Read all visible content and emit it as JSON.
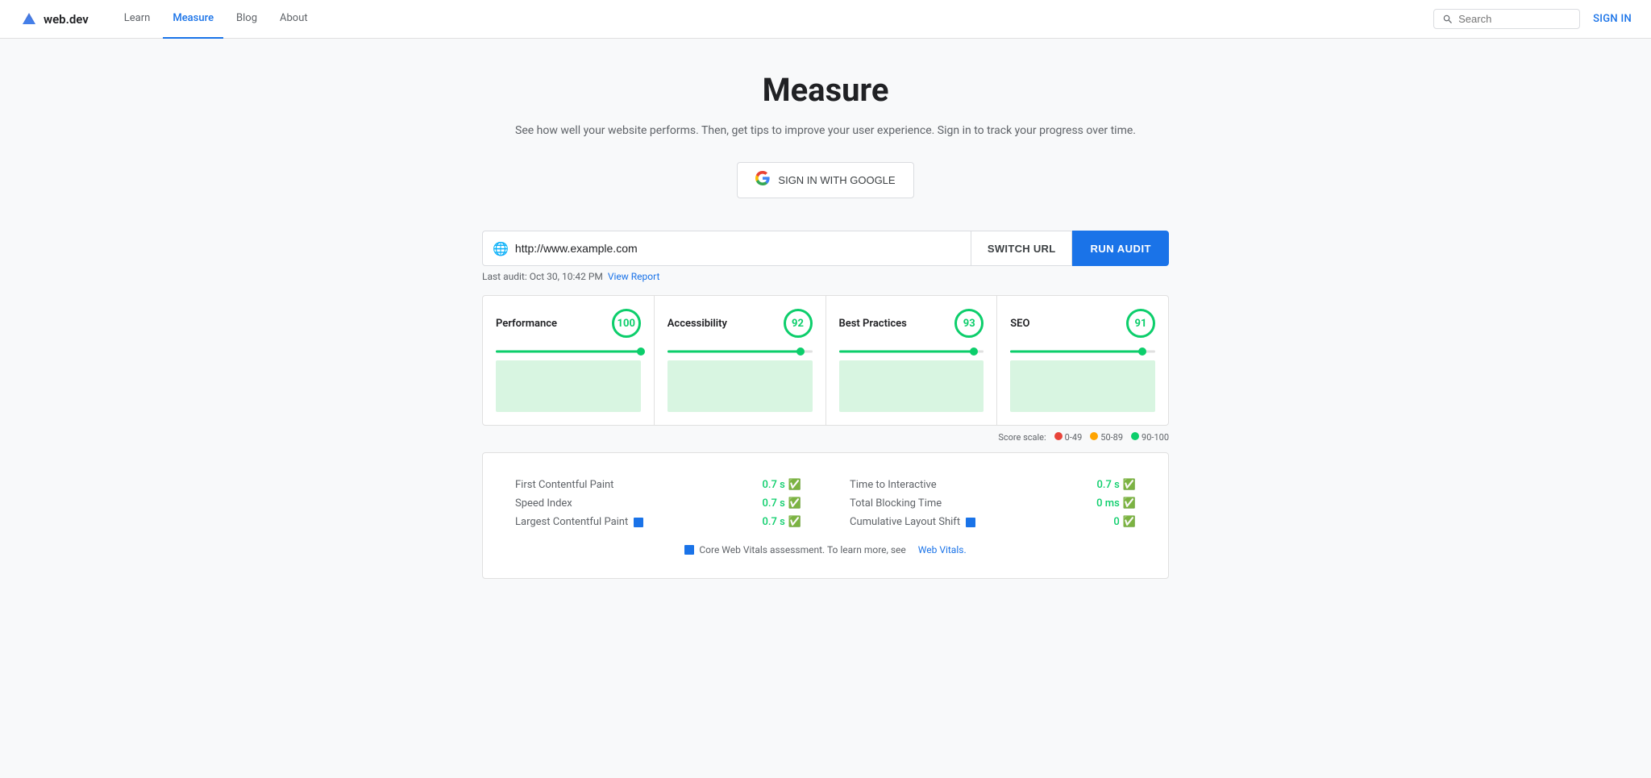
{
  "navbar": {
    "logo_text": "web.dev",
    "links": [
      {
        "label": "Learn",
        "active": false
      },
      {
        "label": "Measure",
        "active": true
      },
      {
        "label": "Blog",
        "active": false
      },
      {
        "label": "About",
        "active": false
      }
    ],
    "search_placeholder": "Search",
    "signin_label": "SIGN IN"
  },
  "hero": {
    "title": "Measure",
    "subtitle": "See how well your website performs. Then, get tips to improve your user\nexperience. Sign in to track your progress over time.",
    "google_btn": "SIGN IN WITH GOOGLE"
  },
  "url_bar": {
    "url_value": "http://www.example.com",
    "switch_label": "SWITCH URL",
    "run_label": "RUN AUDIT",
    "last_audit": "Last audit: Oct 30, 10:42 PM",
    "view_report": "View Report"
  },
  "score_cards": [
    {
      "title": "Performance",
      "score": "100",
      "bar_pct": "100"
    },
    {
      "title": "Accessibility",
      "score": "92",
      "bar_pct": "92"
    },
    {
      "title": "Best Practices",
      "score": "93",
      "bar_pct": "93"
    },
    {
      "title": "SEO",
      "score": "91",
      "bar_pct": "91"
    }
  ],
  "score_scale": {
    "label": "Score scale:",
    "ranges": [
      {
        "color": "#e8443a",
        "label": "0-49"
      },
      {
        "color": "#ffa400",
        "label": "50-89"
      },
      {
        "color": "#0cce6b",
        "label": "90-100"
      }
    ]
  },
  "metrics": {
    "left": [
      {
        "name": "First Contentful Paint",
        "value": "0.7 s",
        "badge": false
      },
      {
        "name": "Speed Index",
        "value": "0.7 s",
        "badge": false
      },
      {
        "name": "Largest Contentful Paint",
        "value": "0.7 s",
        "badge": true
      }
    ],
    "right": [
      {
        "name": "Time to Interactive",
        "value": "0.7 s",
        "badge": false
      },
      {
        "name": "Total Blocking Time",
        "value": "0 ms",
        "badge": false
      },
      {
        "name": "Cumulative Layout Shift",
        "value": "0",
        "badge": true
      }
    ],
    "core_vitals_note": "Core Web Vitals assessment. To learn more, see",
    "core_vitals_link": "Web Vitals."
  }
}
